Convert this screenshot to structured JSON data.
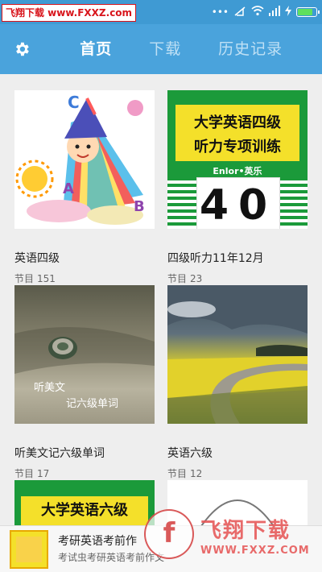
{
  "status_bar": {
    "watermark": "飞翔下载 www.FXXZ.com",
    "indicators": [
      "...",
      "signal-muted-icon",
      "wifi-icon",
      "signal-icon",
      "charging-icon"
    ],
    "battery_color": "#5ee05e"
  },
  "app_bar": {
    "color": "#4aa3dc",
    "settings_icon": "gear-icon",
    "tabs": [
      {
        "label": "首页",
        "active": true
      },
      {
        "label": "下载",
        "active": false
      },
      {
        "label": "历史记录",
        "active": false
      }
    ]
  },
  "grid": {
    "items": [
      {
        "title": "英语四级",
        "count_label": "节目",
        "count": "151"
      },
      {
        "title": "四级听力11年12月",
        "count_label": "节目",
        "count": "23",
        "cover": {
          "line1": "大学英语四级",
          "line2": "听力专项训练",
          "brand": "Enlor•英乐",
          "number": "40"
        }
      },
      {
        "title": "听美文记六级单词",
        "count_label": "节目",
        "count": "17",
        "cover_text": [
          "听美文",
          "记六级单词"
        ]
      },
      {
        "title": "英语六级",
        "count_label": "节目",
        "count": "12"
      },
      {
        "cover": {
          "line1": "大学英语六级"
        }
      },
      {}
    ]
  },
  "now_playing": {
    "title": "考研英语考前作",
    "subtitle": "考试虫考研英语考前作文"
  },
  "watermark_logo": {
    "name": "飞翔下载",
    "url": "WWW.FXXZ.COM"
  }
}
